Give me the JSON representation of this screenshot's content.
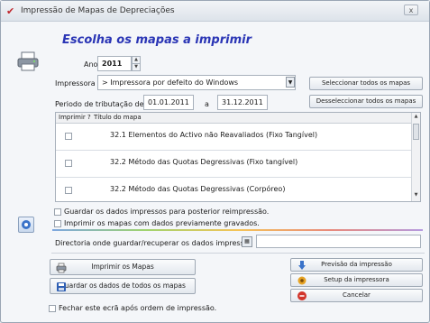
{
  "window": {
    "title": "Impressão de Mapas de Depreciações",
    "close_label": "x",
    "heading": "Escolha os mapas a imprimir"
  },
  "form": {
    "ano_label": "Ano",
    "ano_value": "2011",
    "impressora_label": "Impressora",
    "impressora_value": "> Impressora por defeito do Windows",
    "periodo_label": "Periodo de tributação de",
    "periodo_from": "01.01.2011",
    "periodo_sep": "a",
    "periodo_to": "31.12.2011"
  },
  "side_buttons": {
    "select_all": "Seleccionar todos os mapas",
    "deselect_all": "Desseleccionar todos os mapas"
  },
  "grid": {
    "col_imprimir": "Imprimir ?",
    "col_titulo": "Título do mapa",
    "rows": [
      {
        "title": "32.1 Elementos do Activo não Reavaliados (Fixo Tangível)",
        "checked": false
      },
      {
        "title": "32.2 Método das Quotas Degressivas (Fixo tangível)",
        "checked": false
      },
      {
        "title": "32.2 Método das Quotas Degressivas (Corpóreo)",
        "checked": false
      }
    ]
  },
  "options": {
    "guardar_dados": "Guardar os dados impressos para posterior reimpressão.",
    "imprimir_gravados": "Imprimir os mapas com dados previamente gravados.",
    "directoria_label": "Directoria onde guardar/recuperar os dados impressos"
  },
  "bottom_buttons": {
    "imprimir_mapas": "Imprimir os Mapas",
    "guardar_todos": "Guardar os dados de todos os mapas",
    "previsao": "Previsão da impressão",
    "setup": "Setup da impressora",
    "cancelar": "Cancelar"
  },
  "footer": {
    "fechar_label": "Fechar este ecrã após ordem de impressão."
  }
}
